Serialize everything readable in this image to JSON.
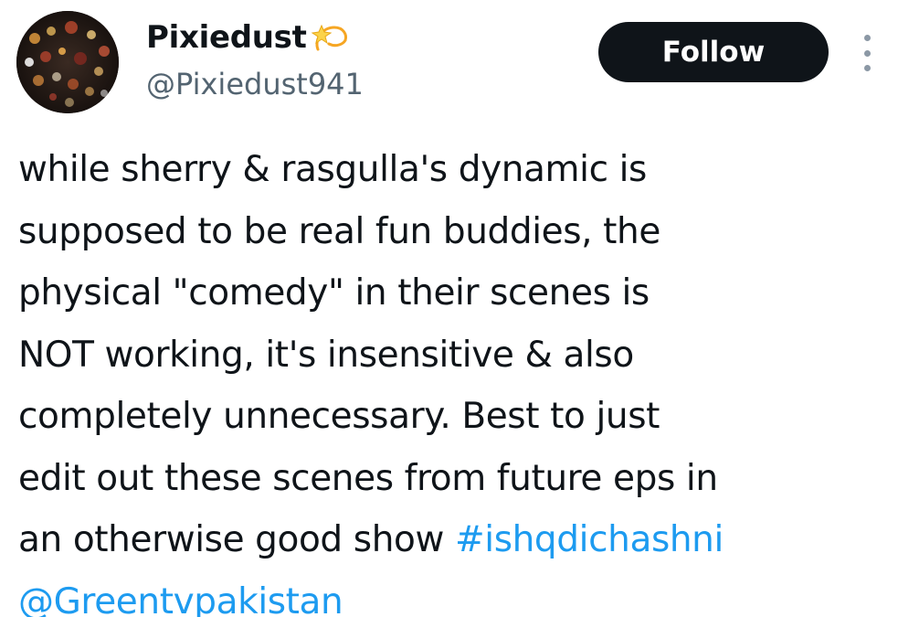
{
  "author": {
    "display_name": "Pixiedust",
    "display_name_emoji": "dizzy-star-icon",
    "handle": "@Pixiedust941",
    "avatar_icon": "bokeh-lights-avatar"
  },
  "actions": {
    "follow_label": "Follow",
    "more_icon": "vertical-ellipsis-icon"
  },
  "tweet": {
    "lines": [
      "while sherry & rasgulla's dynamic is",
      "supposed to be real fun buddies, the",
      "physical \"comedy\" in their scenes is",
      "NOT working, it's insensitive & also",
      "completely unnecessary. Best to just",
      "edit out these scenes from future eps in"
    ],
    "last_line_text": "an otherwise good show ",
    "hashtag": "#ishqdichashni",
    "mention": "@Greentvpakistan"
  },
  "colors": {
    "text": "#0f1419",
    "secondary_text": "#536471",
    "link": "#1d9bf0",
    "follow_button_bg": "#0f1419",
    "follow_button_text": "#ffffff"
  }
}
